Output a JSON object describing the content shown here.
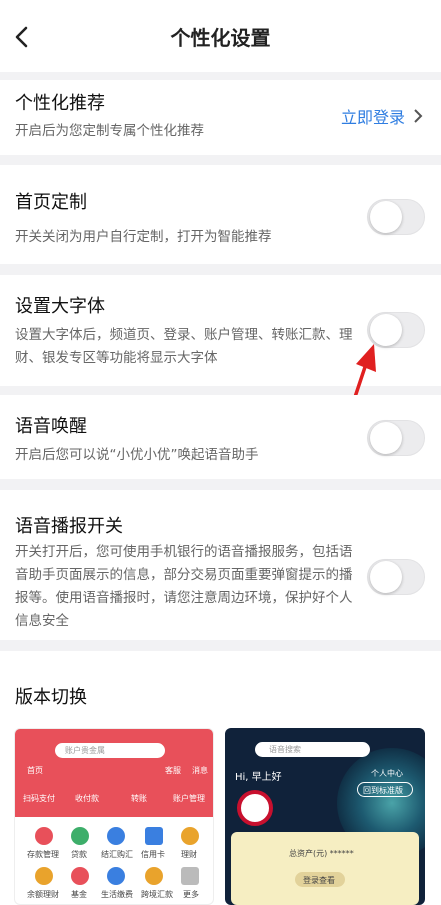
{
  "header": {
    "title": "个性化设置"
  },
  "personal": {
    "title": "个性化推荐",
    "desc": "开启后为您定制专属个性化推荐",
    "login": "立即登录"
  },
  "homepage": {
    "title": "首页定制",
    "desc": "开关关闭为用户自行定制，打开为智能推荐",
    "on": false
  },
  "bigfont": {
    "title": "设置大字体",
    "desc1": "设置大字体后，频道页、登录、账户管理、转账汇款、理",
    "desc2": "财、银发专区等功能将显示大字体",
    "on": false
  },
  "voicewake": {
    "title": "语音唤醒",
    "desc": "开启后您可以说“小优小优”唤起语音助手",
    "on": false
  },
  "voicebroadcast": {
    "title": "语音播报开关",
    "desc1": "开关打开后，您可使用手机银行的语音播报服务，包括语",
    "desc2": "音助手页面展示的信息，部分交易页面重要弹窗提示的播",
    "desc3": "报等。使用语音播报时，请您注意周边环境，保护好个人",
    "desc4": "信息安全",
    "on": false
  },
  "version": {
    "title": "版本切换"
  },
  "preview_std": {
    "search": "账户贵金属",
    "top_icons": [
      "首页",
      "客服",
      "消息"
    ],
    "row1": [
      "扫码支付",
      "收付款",
      "转账",
      "账户管理"
    ],
    "row2": [
      "存款管理",
      "贷款",
      "结汇购汇",
      "信用卡",
      "理财"
    ],
    "row3": [
      "余额理财",
      "基金",
      "生活缴费",
      "跨境汇款",
      "更多"
    ]
  },
  "preview_alt": {
    "search": "语音搜索",
    "greeting": "Hi, 早上好",
    "center": "个人中心",
    "back_std": "回到标准版",
    "assets": "总资产(元) ******",
    "login_btn": "登录查看"
  },
  "colors": {
    "accent": "#2f7de1",
    "red": "#e8505a",
    "arrow": "#e02020"
  }
}
